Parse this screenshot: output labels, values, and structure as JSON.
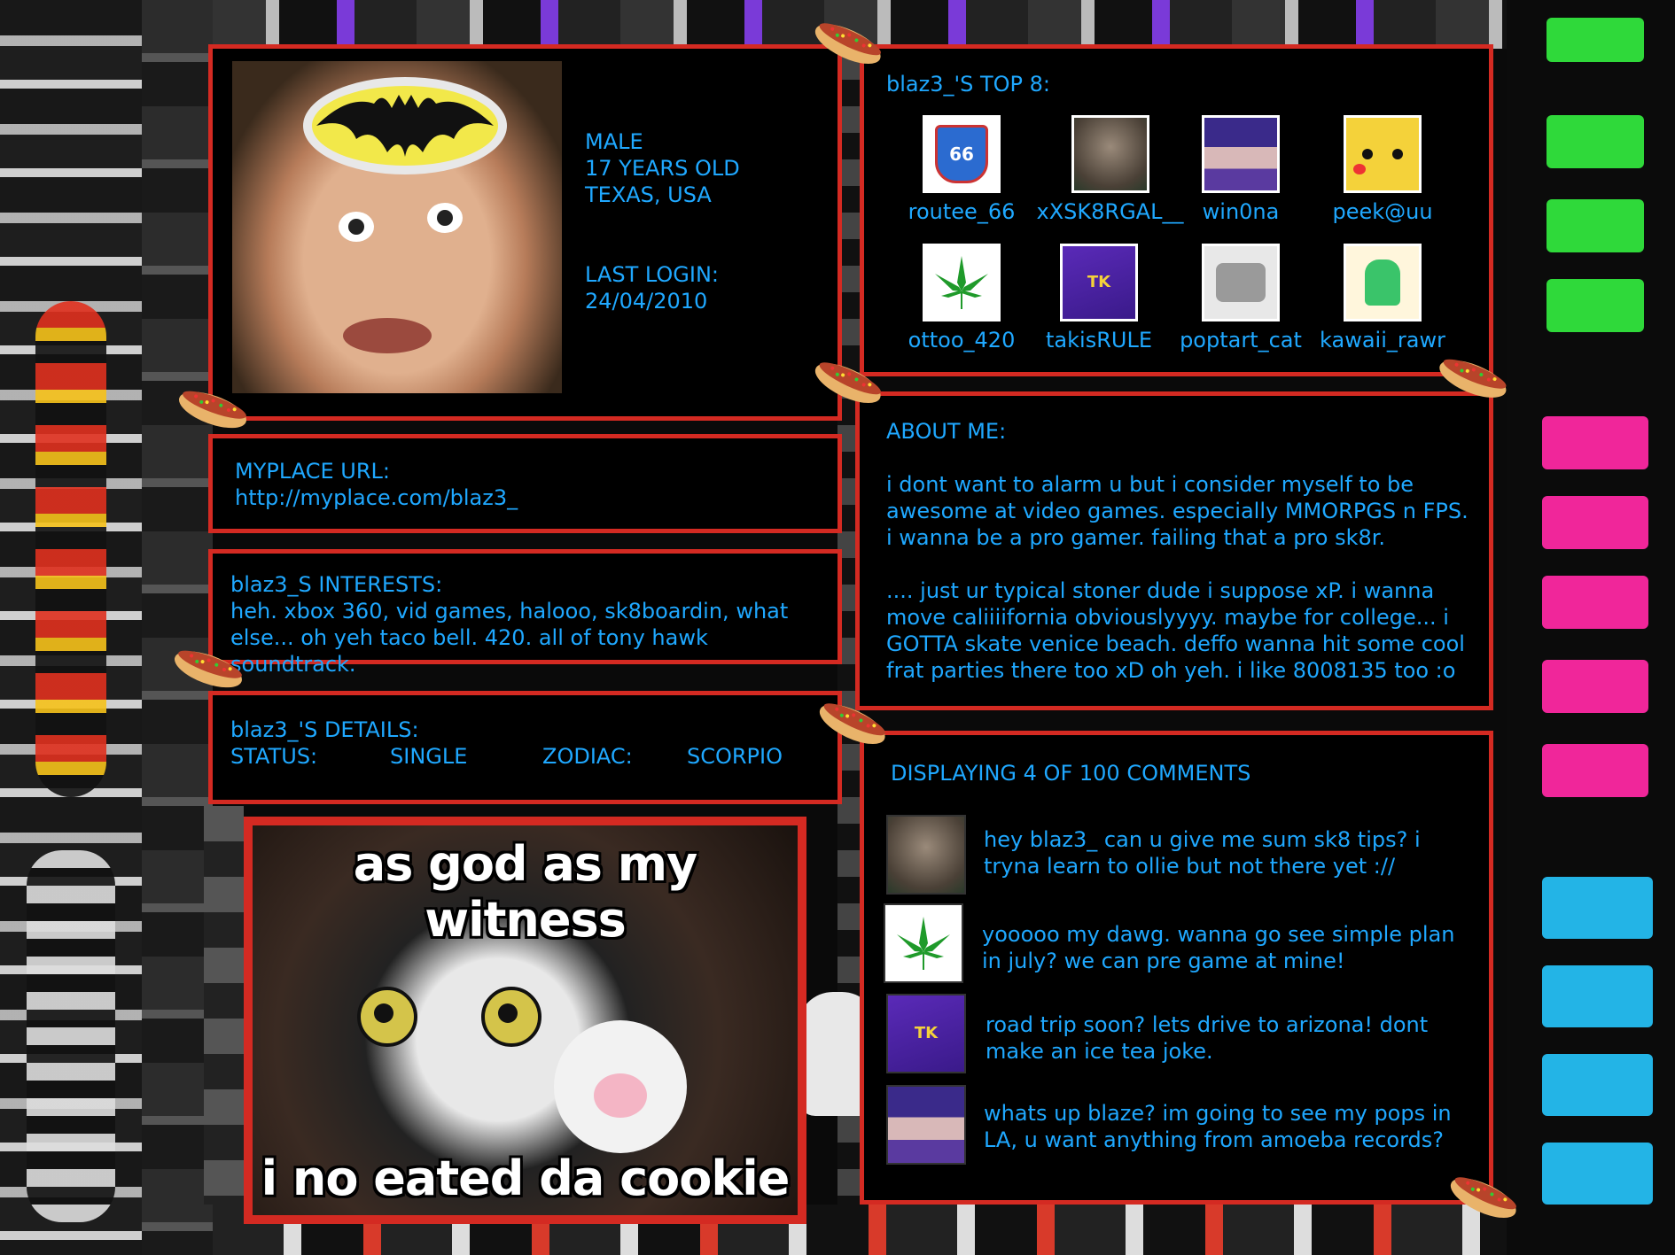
{
  "profile": {
    "gender": "MALE",
    "age": "17 YEARS OLD",
    "location": "TEXAS, USA",
    "last_login_label": "LAST LOGIN:",
    "last_login_date": "24/04/2010",
    "photo_icon": "batman-mask-photo"
  },
  "url_box": {
    "label": "MYPLACE URL:",
    "url": "http://myplace.com/blaz3_"
  },
  "interests": {
    "label": "blaz3_S INTERESTS:",
    "text": "heh. xbox 360, vid games, halooo, sk8boardin, what else... oh yeh taco bell. 420. all of tony hawk soundtrack."
  },
  "details": {
    "label": "blaz3_'S DETAILS:",
    "status_label": "STATUS:",
    "status_value": "SINGLE",
    "zodiac_label": "ZODIAC:",
    "zodiac_value": "SCORPIO"
  },
  "meme": {
    "top": "as god as my witness",
    "bottom": "i no eated da cookie"
  },
  "top8": {
    "title": "blaz3_'S TOP 8:",
    "friends": [
      {
        "name": "routee_66",
        "icon": "route-66-sign-icon"
      },
      {
        "name": "xXSK8RGAL__",
        "icon": "girl-photo-icon"
      },
      {
        "name": "win0na",
        "icon": "emo-girl-icon"
      },
      {
        "name": "peek@uu",
        "icon": "pikachu-icon"
      },
      {
        "name": "ottoo_420",
        "icon": "weed-leaf-icon"
      },
      {
        "name": "takisRULE",
        "icon": "takis-bag-icon"
      },
      {
        "name": "poptart_cat",
        "icon": "cat-pixel-icon"
      },
      {
        "name": "kawaii_rawr",
        "icon": "dino-pixel-icon"
      }
    ]
  },
  "about": {
    "title": "ABOUT ME:",
    "p1": "i dont want to alarm u but i consider myself to be awesome at video games. especially MMORPGS n FPS. i wanna be a pro gamer. failing that a pro sk8r.",
    "p2": ".... just ur typical stoner dude i suppose xP. i wanna move caliiiifornia obviouslyyyy. maybe for college... i GOTTA skate venice beach.  deffo wanna hit some cool frat parties there too xD oh yeh. i like 8008135 too :o"
  },
  "comments": {
    "title": "DISPLAYING 4 OF 100 COMMENTS",
    "items": [
      {
        "text": "hey blaz3_ can u give me sum sk8 tips? i tryna learn to ollie but not there yet ://",
        "icon": "girl-photo-icon"
      },
      {
        "text": "yooooo my dawg. wanna go see simple plan in july? we can pre game at mine!",
        "icon": "weed-leaf-icon"
      },
      {
        "text": "road trip soon? lets drive to arizona! dont make an ice tea joke.",
        "icon": "takis-bag-icon"
      },
      {
        "text": "whats up blaze? im going to see my pops in LA, u want anything from amoeba records?",
        "icon": "emo-girl-icon"
      }
    ]
  },
  "colors": {
    "text": "#1fa8ff",
    "border": "#d42a22",
    "panel": "#000000"
  }
}
